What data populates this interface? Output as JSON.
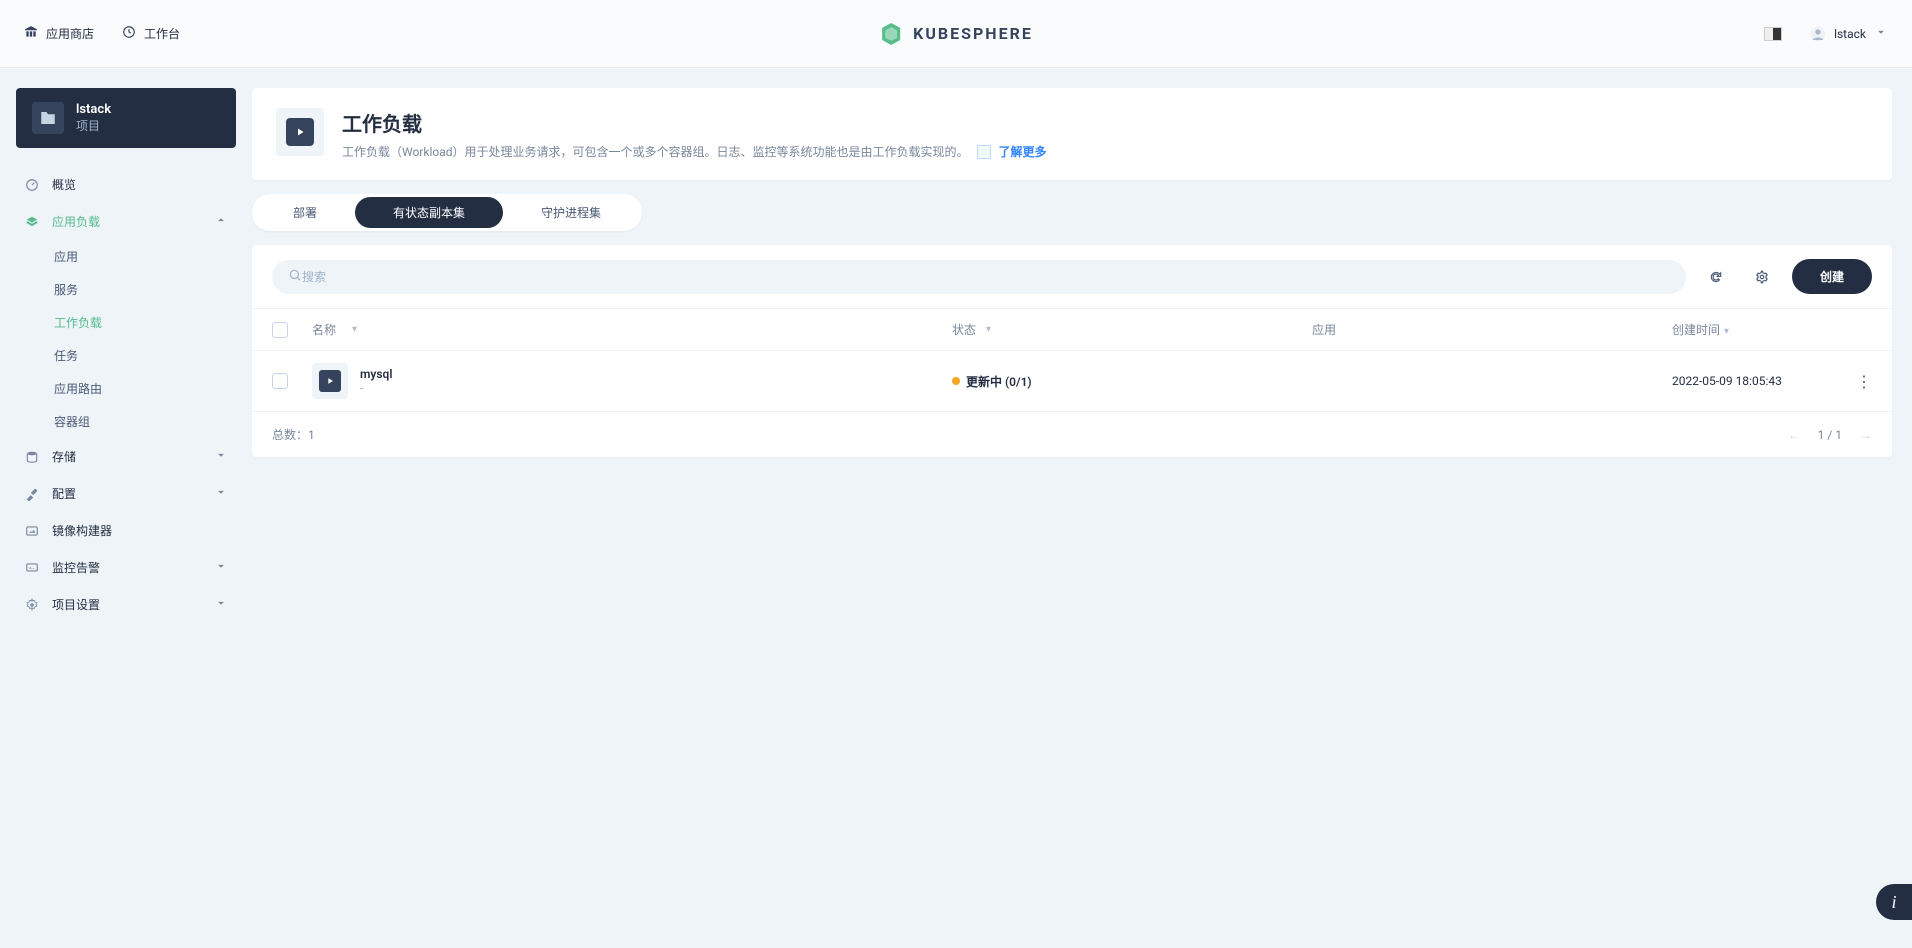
{
  "header": {
    "app_store": "应用商店",
    "workbench": "工作台",
    "brand": "KUBESPHERE",
    "username": "lstack"
  },
  "project": {
    "name": "lstack",
    "type": "项目"
  },
  "sidebar": {
    "overview": "概览",
    "app_load": "应用负载",
    "app_load_children": {
      "apps": "应用",
      "services": "服务",
      "workloads": "工作负载",
      "jobs": "任务",
      "routes": "应用路由",
      "pods": "容器组"
    },
    "storage": "存储",
    "config": "配置",
    "image_builder": "镜像构建器",
    "monitor": "监控告警",
    "project_settings": "项目设置"
  },
  "page": {
    "title": "工作负载",
    "description": "工作负载（Workload）用于处理业务请求，可包含一个或多个容器组。日志、监控等系统功能也是由工作负载实现的。",
    "learn_more": "了解更多"
  },
  "tabs": {
    "deploy": "部署",
    "stateful": "有状态副本集",
    "daemon": "守护进程集"
  },
  "toolbar": {
    "search_placeholder": "搜索",
    "create": "创建"
  },
  "columns": {
    "name": "名称",
    "status": "状态",
    "app": "应用",
    "created": "创建时间"
  },
  "rows": [
    {
      "name": "mysql",
      "sub": "-",
      "status": "更新中 (0/1)",
      "app": "",
      "created": "2022-05-09 18:05:43"
    }
  ],
  "footer": {
    "total_label": "总数：",
    "total": "1",
    "page": "1 / 1"
  }
}
